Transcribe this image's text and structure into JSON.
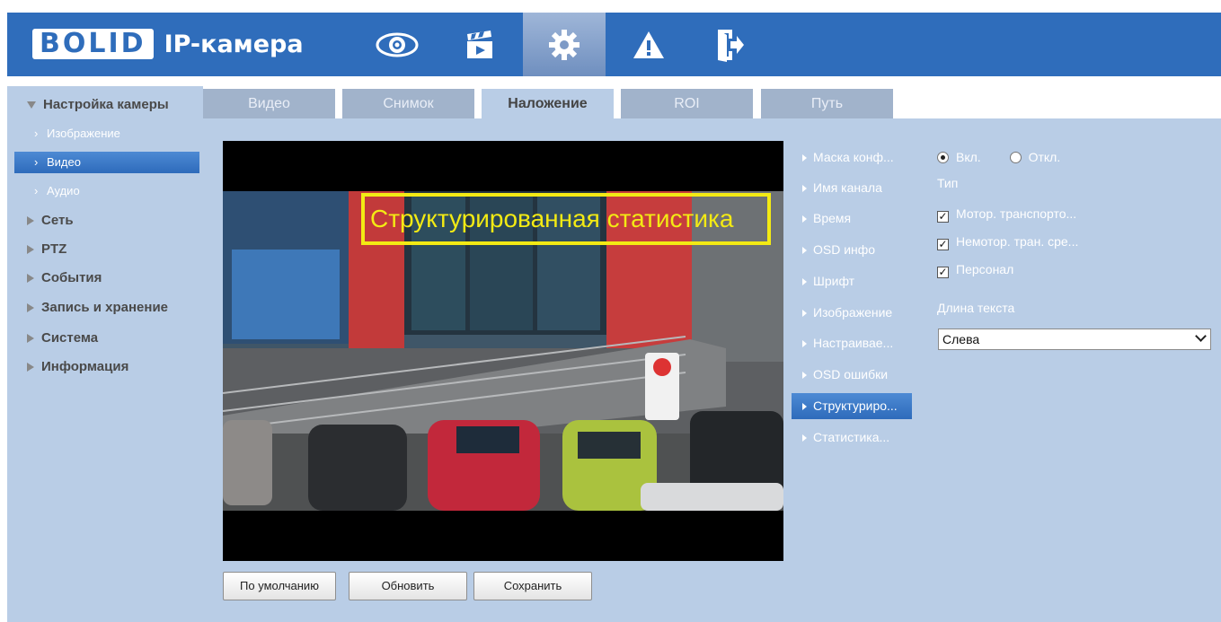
{
  "header": {
    "logo_brand": "BOLID",
    "logo_title": "IP-камера",
    "nav": [
      {
        "name": "live-view",
        "icon": "eye-icon"
      },
      {
        "name": "playback",
        "icon": "clapperboard-icon"
      },
      {
        "name": "setup",
        "icon": "gear-icon"
      },
      {
        "name": "alarm",
        "icon": "warning-icon"
      },
      {
        "name": "logout",
        "icon": "logout-icon"
      }
    ],
    "accent": "#2f6dbb"
  },
  "sidebar": {
    "camera_settings": "Настройка камеры",
    "sub_image": "Изображение",
    "sub_video": "Видео",
    "sub_audio": "Аудио",
    "network": "Сеть",
    "ptz": "PTZ",
    "events": "События",
    "storage": "Запись и хранение",
    "system": "Система",
    "info": "Информация"
  },
  "tabs": [
    "Видео",
    "Снимок",
    "Наложение",
    "ROI",
    "Путь"
  ],
  "preview": {
    "overlay_text": "Структурированная статистика"
  },
  "buttons": {
    "default": "По умолчанию",
    "refresh": "Обновить",
    "save": "Сохранить"
  },
  "overlay_menu": [
    "Маска конф...",
    "Имя канала",
    "Время",
    "OSD инфо",
    "Шрифт",
    "Изображение",
    "Настраивае...",
    "OSD ошибки",
    "Структуриро...",
    "Статистика..."
  ],
  "settings": {
    "radio_on": "Вкл.",
    "radio_off": "Откл.",
    "type_label": "Тип",
    "check_motor": "Мотор. транспорто...",
    "check_nonmotor": "Немотор. тран. сре...",
    "check_person": "Персонал",
    "text_length_label": "Длина текста",
    "text_length_value": "Слева"
  }
}
